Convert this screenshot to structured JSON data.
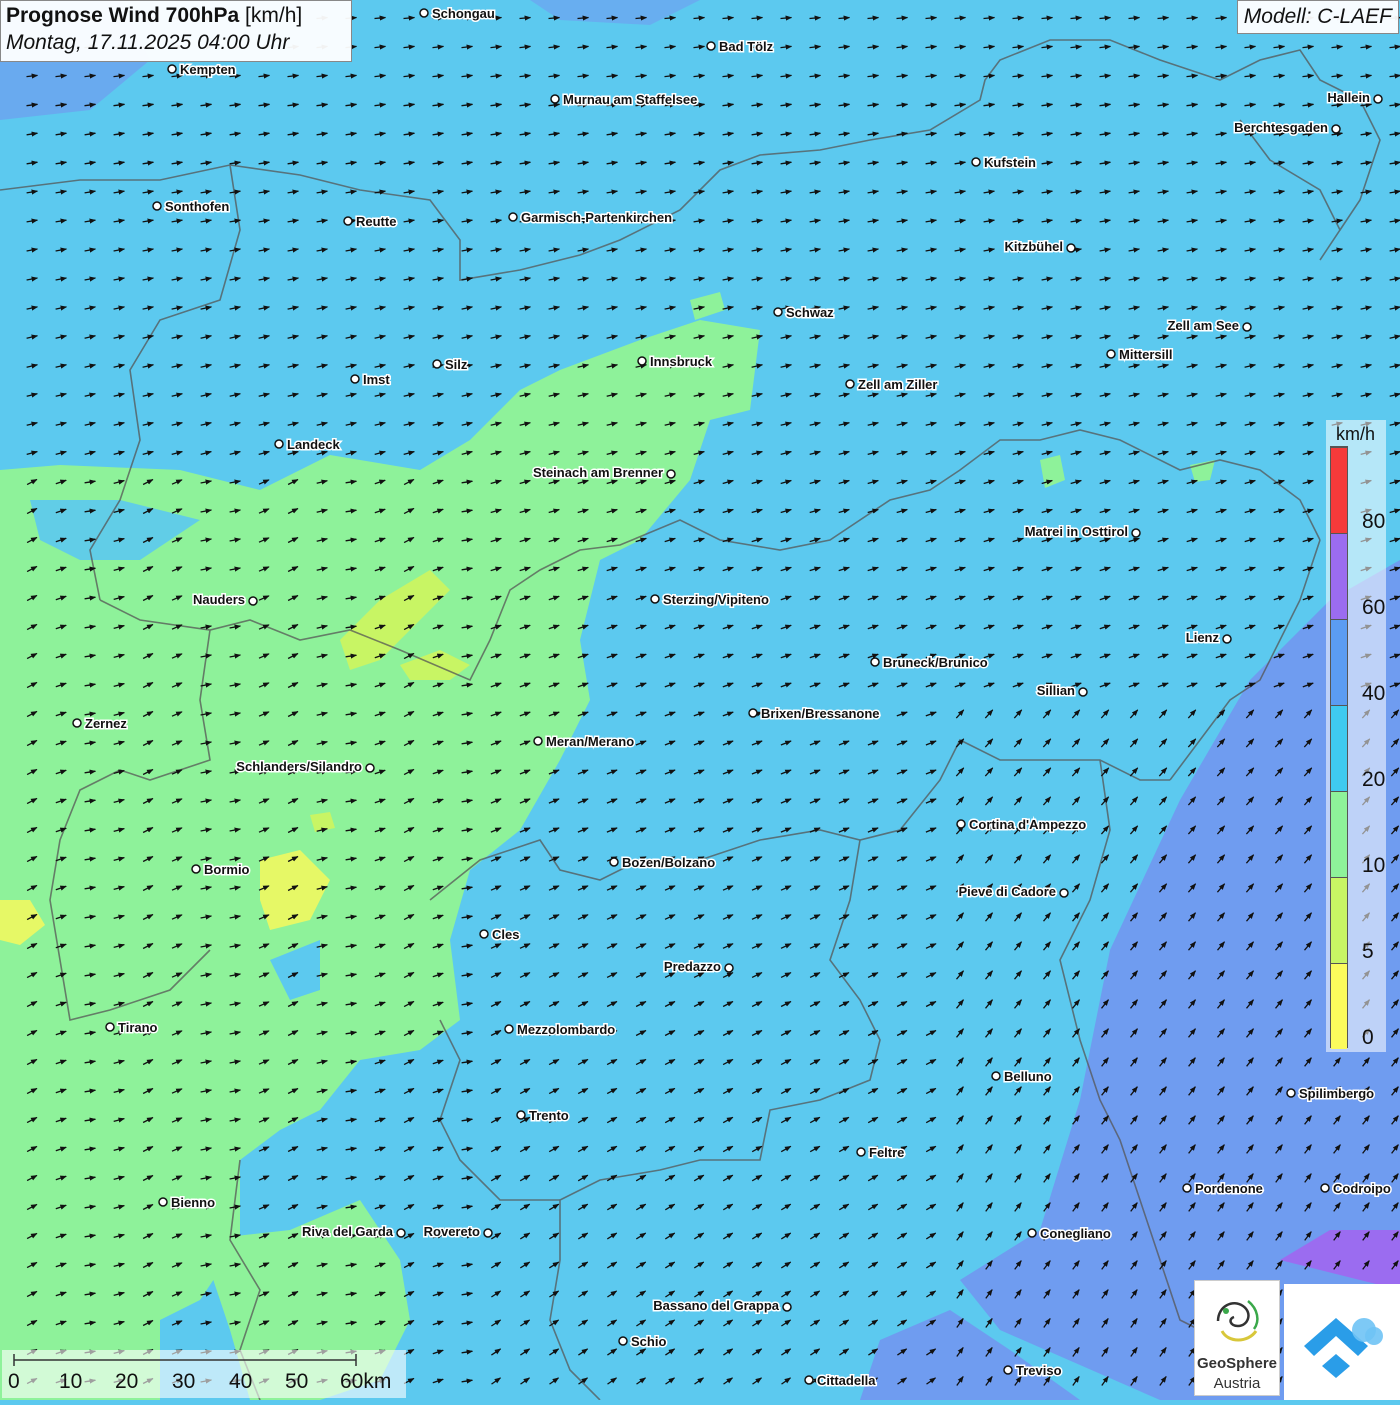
{
  "header": {
    "title": "Prognose Wind 700hPa",
    "unit": "[km/h]",
    "datetime": "Montag, 17.11.2025 04:00 Uhr",
    "model": "Modell: C-LAEF"
  },
  "legend": {
    "unit": "km/h",
    "classes": [
      {
        "from": 0,
        "to": 5,
        "color": "#fbfb5c"
      },
      {
        "from": 5,
        "to": 10,
        "color": "#c8f564"
      },
      {
        "from": 10,
        "to": 20,
        "color": "#8ef29a"
      },
      {
        "from": 20,
        "to": 40,
        "color": "#3fcaf0"
      },
      {
        "from": 40,
        "to": 60,
        "color": "#5b9cf2"
      },
      {
        "from": 60,
        "to": 80,
        "color": "#9b6cf0"
      },
      {
        "from": 80,
        "to": 100,
        "color": "#f53a3a"
      }
    ],
    "ticks": [
      "0",
      "5",
      "10",
      "20",
      "40",
      "60",
      "80"
    ]
  },
  "scale_bar": {
    "labels": [
      "0",
      "10",
      "20",
      "30",
      "40",
      "50",
      "60km"
    ]
  },
  "cities": [
    {
      "name": "Schongau",
      "dot": "left"
    },
    {
      "name": "Bad Tölz",
      "dot": "left"
    },
    {
      "name": "Kempten",
      "dot": "left"
    },
    {
      "name": "Murnau am Staffelsee",
      "dot": "left"
    },
    {
      "name": "Hallein",
      "dot": "right"
    },
    {
      "name": "Berchtesgaden",
      "dot": "right"
    },
    {
      "name": "Kufstein",
      "dot": "left"
    },
    {
      "name": "Sonthofen",
      "dot": "left"
    },
    {
      "name": "Reutte",
      "dot": "left"
    },
    {
      "name": "Garmisch-Partenkirchen",
      "dot": "left"
    },
    {
      "name": "Kitzbühel",
      "dot": "right"
    },
    {
      "name": "Schwaz",
      "dot": "left"
    },
    {
      "name": "Zell am See",
      "dot": "right"
    },
    {
      "name": "Innsbruck",
      "dot": "left"
    },
    {
      "name": "Silz",
      "dot": "left"
    },
    {
      "name": "Mittersill",
      "dot": "left"
    },
    {
      "name": "Imst",
      "dot": "left"
    },
    {
      "name": "Zell am Ziller",
      "dot": "left"
    },
    {
      "name": "Landeck",
      "dot": "left"
    },
    {
      "name": "Steinach am Brenner",
      "dot": "right"
    },
    {
      "name": "Matrei in Osttirol",
      "dot": "right"
    },
    {
      "name": "Nauders",
      "dot": "right"
    },
    {
      "name": "Sterzing/Vipiteno",
      "dot": "left"
    },
    {
      "name": "Lienz",
      "dot": "right"
    },
    {
      "name": "Bruneck/Brunico",
      "dot": "left"
    },
    {
      "name": "Sillian",
      "dot": "right"
    },
    {
      "name": "Brixen/Bressanone",
      "dot": "left"
    },
    {
      "name": "Zernez",
      "dot": "left"
    },
    {
      "name": "Meran/Merano",
      "dot": "left"
    },
    {
      "name": "Schlanders/Silandro",
      "dot": "right"
    },
    {
      "name": "Cortina d'Ampezzo",
      "dot": "left"
    },
    {
      "name": "Bozen/Bolzano",
      "dot": "left"
    },
    {
      "name": "Bormio",
      "dot": "left"
    },
    {
      "name": "Pieve di Cadore",
      "dot": "right"
    },
    {
      "name": "Cles",
      "dot": "left"
    },
    {
      "name": "Predazzo",
      "dot": "right"
    },
    {
      "name": "Tirano",
      "dot": "left"
    },
    {
      "name": "Mezzolombardo",
      "dot": "left"
    },
    {
      "name": "Belluno",
      "dot": "left"
    },
    {
      "name": "Spilimbergo",
      "dot": "left"
    },
    {
      "name": "Trento",
      "dot": "left"
    },
    {
      "name": "Feltre",
      "dot": "left"
    },
    {
      "name": "Pordenone",
      "dot": "left"
    },
    {
      "name": "Codroipo",
      "dot": "left"
    },
    {
      "name": "Bienno",
      "dot": "left"
    },
    {
      "name": "Riva del Garda",
      "dot": "right"
    },
    {
      "name": "Rovereto",
      "dot": "right"
    },
    {
      "name": "Conegliano",
      "dot": "left"
    },
    {
      "name": "Bassano del Grappa",
      "dot": "right"
    },
    {
      "name": "Schio",
      "dot": "left"
    },
    {
      "name": "Treviso",
      "dot": "left"
    },
    {
      "name": "Cittadella",
      "dot": "left"
    }
  ],
  "logos": {
    "geosphere_line1": "GeoSphere",
    "geosphere_line2": "Austria"
  },
  "colors": {
    "field_main": "#5cc9ef",
    "field_calm": "#8ef29a",
    "field_strong": "#6f9cf0",
    "arrow": "#111111"
  }
}
